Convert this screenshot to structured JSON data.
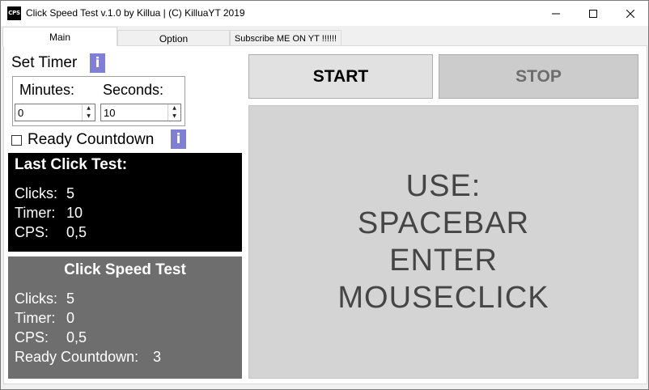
{
  "window": {
    "title": "Click Speed Test v.1.0 by Killua | (C) KilluaYT 2019",
    "icon_text": "CPS"
  },
  "tabs": [
    {
      "label": "Main",
      "active": true
    },
    {
      "label": "Option",
      "active": false
    },
    {
      "label": "Subscribe ME ON YT !!!!!!",
      "active": false
    }
  ],
  "timer": {
    "heading": "Set Timer",
    "info_label": "i",
    "minutes_label": "Minutes:",
    "seconds_label": "Seconds:",
    "minutes_value": "0",
    "seconds_value": "10"
  },
  "ready_countdown": {
    "label": "Ready Countdown",
    "checked": false,
    "info_label": "i"
  },
  "last_test": {
    "title": "Last Click Test:",
    "clicks_label": "Clicks:",
    "clicks_value": "5",
    "timer_label": "Timer:",
    "timer_value": "10",
    "cps_label": "CPS:",
    "cps_value": "0,5"
  },
  "current_test": {
    "title": "Click Speed Test",
    "clicks_label": "Clicks:",
    "clicks_value": "5",
    "timer_label": "Timer:",
    "timer_value": "0",
    "cps_label": "CPS:",
    "cps_value": "0,5",
    "ready_label": "Ready Countdown:",
    "ready_value": "3"
  },
  "buttons": {
    "start": "START",
    "stop": "STOP"
  },
  "click_area": {
    "lines": [
      "USE:",
      "SPACEBAR",
      "ENTER",
      "MOUSECLICK"
    ]
  },
  "colors": {
    "info_button": "#7f7fd6",
    "last_test_bg": "#000000",
    "current_test_bg": "#6e6e6e",
    "start_bg": "#e1e1e1",
    "stop_bg": "#cccccc",
    "click_area_bg": "#d4d4d4"
  }
}
